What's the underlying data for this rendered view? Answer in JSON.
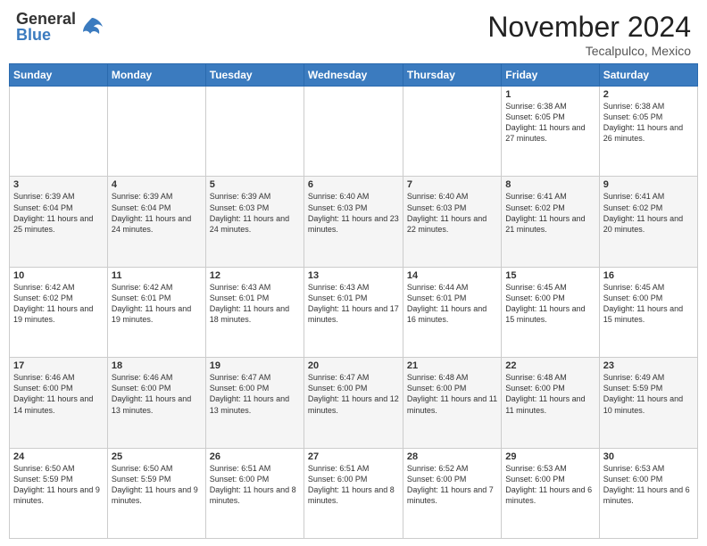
{
  "header": {
    "logo_general": "General",
    "logo_blue": "Blue",
    "month_title": "November 2024",
    "location": "Tecalpulco, Mexico"
  },
  "weekdays": [
    "Sunday",
    "Monday",
    "Tuesday",
    "Wednesday",
    "Thursday",
    "Friday",
    "Saturday"
  ],
  "weeks": [
    [
      {
        "num": "",
        "info": ""
      },
      {
        "num": "",
        "info": ""
      },
      {
        "num": "",
        "info": ""
      },
      {
        "num": "",
        "info": ""
      },
      {
        "num": "",
        "info": ""
      },
      {
        "num": "1",
        "info": "Sunrise: 6:38 AM\nSunset: 6:05 PM\nDaylight: 11 hours and 27 minutes."
      },
      {
        "num": "2",
        "info": "Sunrise: 6:38 AM\nSunset: 6:05 PM\nDaylight: 11 hours and 26 minutes."
      }
    ],
    [
      {
        "num": "3",
        "info": "Sunrise: 6:39 AM\nSunset: 6:04 PM\nDaylight: 11 hours and 25 minutes."
      },
      {
        "num": "4",
        "info": "Sunrise: 6:39 AM\nSunset: 6:04 PM\nDaylight: 11 hours and 24 minutes."
      },
      {
        "num": "5",
        "info": "Sunrise: 6:39 AM\nSunset: 6:03 PM\nDaylight: 11 hours and 24 minutes."
      },
      {
        "num": "6",
        "info": "Sunrise: 6:40 AM\nSunset: 6:03 PM\nDaylight: 11 hours and 23 minutes."
      },
      {
        "num": "7",
        "info": "Sunrise: 6:40 AM\nSunset: 6:03 PM\nDaylight: 11 hours and 22 minutes."
      },
      {
        "num": "8",
        "info": "Sunrise: 6:41 AM\nSunset: 6:02 PM\nDaylight: 11 hours and 21 minutes."
      },
      {
        "num": "9",
        "info": "Sunrise: 6:41 AM\nSunset: 6:02 PM\nDaylight: 11 hours and 20 minutes."
      }
    ],
    [
      {
        "num": "10",
        "info": "Sunrise: 6:42 AM\nSunset: 6:02 PM\nDaylight: 11 hours and 19 minutes."
      },
      {
        "num": "11",
        "info": "Sunrise: 6:42 AM\nSunset: 6:01 PM\nDaylight: 11 hours and 19 minutes."
      },
      {
        "num": "12",
        "info": "Sunrise: 6:43 AM\nSunset: 6:01 PM\nDaylight: 11 hours and 18 minutes."
      },
      {
        "num": "13",
        "info": "Sunrise: 6:43 AM\nSunset: 6:01 PM\nDaylight: 11 hours and 17 minutes."
      },
      {
        "num": "14",
        "info": "Sunrise: 6:44 AM\nSunset: 6:01 PM\nDaylight: 11 hours and 16 minutes."
      },
      {
        "num": "15",
        "info": "Sunrise: 6:45 AM\nSunset: 6:00 PM\nDaylight: 11 hours and 15 minutes."
      },
      {
        "num": "16",
        "info": "Sunrise: 6:45 AM\nSunset: 6:00 PM\nDaylight: 11 hours and 15 minutes."
      }
    ],
    [
      {
        "num": "17",
        "info": "Sunrise: 6:46 AM\nSunset: 6:00 PM\nDaylight: 11 hours and 14 minutes."
      },
      {
        "num": "18",
        "info": "Sunrise: 6:46 AM\nSunset: 6:00 PM\nDaylight: 11 hours and 13 minutes."
      },
      {
        "num": "19",
        "info": "Sunrise: 6:47 AM\nSunset: 6:00 PM\nDaylight: 11 hours and 13 minutes."
      },
      {
        "num": "20",
        "info": "Sunrise: 6:47 AM\nSunset: 6:00 PM\nDaylight: 11 hours and 12 minutes."
      },
      {
        "num": "21",
        "info": "Sunrise: 6:48 AM\nSunset: 6:00 PM\nDaylight: 11 hours and 11 minutes."
      },
      {
        "num": "22",
        "info": "Sunrise: 6:48 AM\nSunset: 6:00 PM\nDaylight: 11 hours and 11 minutes."
      },
      {
        "num": "23",
        "info": "Sunrise: 6:49 AM\nSunset: 5:59 PM\nDaylight: 11 hours and 10 minutes."
      }
    ],
    [
      {
        "num": "24",
        "info": "Sunrise: 6:50 AM\nSunset: 5:59 PM\nDaylight: 11 hours and 9 minutes."
      },
      {
        "num": "25",
        "info": "Sunrise: 6:50 AM\nSunset: 5:59 PM\nDaylight: 11 hours and 9 minutes."
      },
      {
        "num": "26",
        "info": "Sunrise: 6:51 AM\nSunset: 6:00 PM\nDaylight: 11 hours and 8 minutes."
      },
      {
        "num": "27",
        "info": "Sunrise: 6:51 AM\nSunset: 6:00 PM\nDaylight: 11 hours and 8 minutes."
      },
      {
        "num": "28",
        "info": "Sunrise: 6:52 AM\nSunset: 6:00 PM\nDaylight: 11 hours and 7 minutes."
      },
      {
        "num": "29",
        "info": "Sunrise: 6:53 AM\nSunset: 6:00 PM\nDaylight: 11 hours and 6 minutes."
      },
      {
        "num": "30",
        "info": "Sunrise: 6:53 AM\nSunset: 6:00 PM\nDaylight: 11 hours and 6 minutes."
      }
    ]
  ]
}
